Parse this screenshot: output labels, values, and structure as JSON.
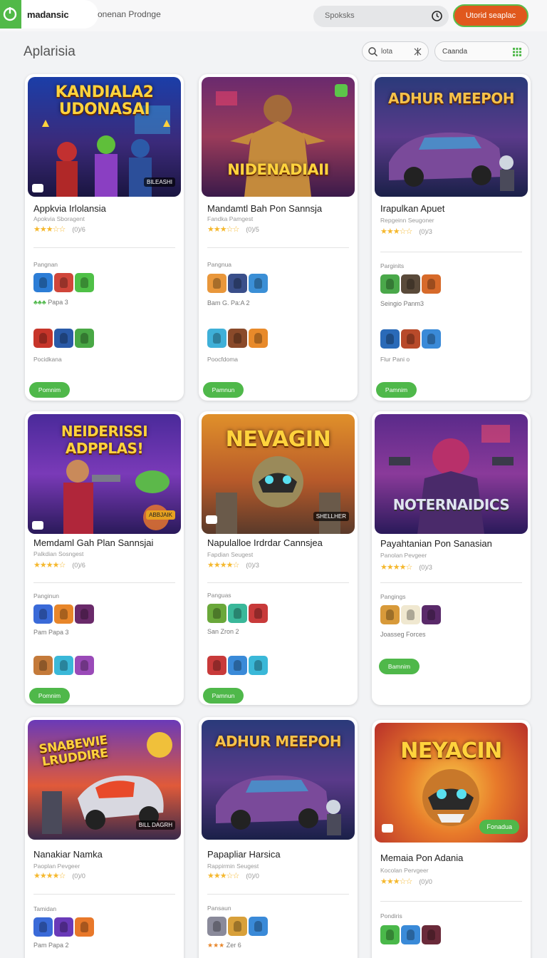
{
  "topbar": {
    "brand": "madansic",
    "subtitle": "onenan Prodnge",
    "search_placeholder": "Spoksks",
    "cta": "Utorid seaplac"
  },
  "header": {
    "title": "Aplarisia",
    "filter_label": "lota",
    "category_label": "Caanda"
  },
  "colors": {
    "brand_green": "#52b948",
    "cta_orange": "#e0581d",
    "star": "#f5b82e"
  },
  "cards": [
    {
      "cover_title": "KANDIALA2 UDONASAI",
      "cover_badge": "BILEASHI",
      "title": "Appkvia Irlolansia",
      "developer": "Apokvia Sboragent",
      "rating": "★★★☆☆",
      "count": "(0)/6",
      "section1": "Pangnan",
      "caption1": "Papa 3",
      "section2": "Pocidkana",
      "button": "Pomnim"
    },
    {
      "cover_title": "NIDENADIAII",
      "title": "Mandamtl Bah Pon Sannsja",
      "developer": "Fandka Pamgest",
      "rating": "★★★☆☆",
      "count": "(0)/5",
      "section1": "Pangnua",
      "caption1": "Bam G. Pa:A 2",
      "section2": "Poocfdoma",
      "button": "Pamnun"
    },
    {
      "cover_title": "ADHUR MEEPOH",
      "title": "Irapulkan Apuet",
      "developer": "Repgeinn Seugoner",
      "rating": "★★★☆☆",
      "count": "(0)/3",
      "section1": "Parginits",
      "caption1": "Seingio Panm3",
      "section2": "Flur Pani o",
      "button": "Pamnim"
    },
    {
      "cover_title": "NEIDERISSI ADPPLAS!",
      "cover_badge": "ABBJAIK",
      "title": "Memdaml Gah Plan Sannsjai",
      "developer": "Palkdian Sosngest",
      "rating": "★★★★☆",
      "count": "(0)/6",
      "section1": "Panginun",
      "caption1": "Pam Papa 3",
      "button": "Pomnim"
    },
    {
      "cover_title": "NEVAGIN",
      "cover_badge": "SHELLHER",
      "title": "Napulalloe Irdrdar Cannsjea",
      "developer": "Fapdian Seugest",
      "rating": "★★★★☆",
      "count": "(0)/3",
      "section1": "Panguas",
      "caption1": "San Zron 2",
      "button": "Pamnun"
    },
    {
      "cover_title": "NOTERNAIDICS",
      "title": "Payahtanian Pon Sanasian",
      "developer": "Panolan Pevgeer",
      "rating": "★★★★☆",
      "count": "(0)/3",
      "section1": "Pangings",
      "caption1": "Joasseg Forces",
      "button": "Bamnim"
    },
    {
      "cover_title": "SNABEWIE LRUDDIRE",
      "cover_badge": "BILL DAGRH",
      "title": "Nanakiar Namka",
      "developer": "Paoplan Pevgeer",
      "rating": "★★★★☆",
      "count": "(0)/0",
      "section1": "Tamidan",
      "caption1": "Pam Papa 2"
    },
    {
      "cover_title": "ADHUR MEEPOH",
      "title": "Papapliar Harsica",
      "developer": "Rappirmin Seugest",
      "rating": "★★★☆☆",
      "count": "(0)/0",
      "section1": "Pansaun",
      "caption1": "Zer 6"
    },
    {
      "cover_title": "NEYACIN",
      "cover_pill": "Fonadua",
      "title": "Memaia Pon Adania",
      "developer": "Kocolan Pervgeer",
      "rating": "★★★☆☆",
      "count": "(0)/0",
      "section1": "Pondiris"
    }
  ]
}
